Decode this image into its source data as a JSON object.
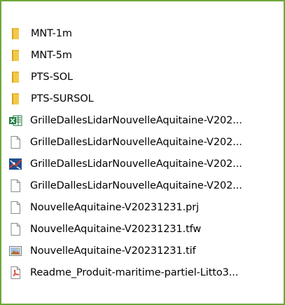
{
  "file_list": {
    "items": [
      {
        "icon": "folder-icon",
        "label": "MNT-1m"
      },
      {
        "icon": "folder-icon",
        "label": "MNT-5m"
      },
      {
        "icon": "folder-icon",
        "label": "PTS-SOL"
      },
      {
        "icon": "folder-icon",
        "label": "PTS-SURSOL"
      },
      {
        "icon": "excel-file-icon",
        "label": "GrilleDallesLidarNouvelleAquitaine-V202..."
      },
      {
        "icon": "generic-file-icon",
        "label": "GrilleDallesLidarNouvelleAquitaine-V202..."
      },
      {
        "icon": "gis-file-icon",
        "label": "GrilleDallesLidarNouvelleAquitaine-V202..."
      },
      {
        "icon": "generic-file-icon",
        "label": "GrilleDallesLidarNouvelleAquitaine-V202..."
      },
      {
        "icon": "generic-file-icon",
        "label": "NouvelleAquitaine-V20231231.prj"
      },
      {
        "icon": "generic-file-icon",
        "label": "NouvelleAquitaine-V20231231.tfw"
      },
      {
        "icon": "image-file-icon",
        "label": "NouvelleAquitaine-V20231231.tif"
      },
      {
        "icon": "pdf-file-icon",
        "label": "Readme_Produit-maritime-partiel-Litto3..."
      }
    ]
  },
  "colors": {
    "frame_border": "#6fa63a",
    "folder": "#e8b530",
    "excel": "#1d7a3f",
    "pdf": "#d23a2a"
  }
}
